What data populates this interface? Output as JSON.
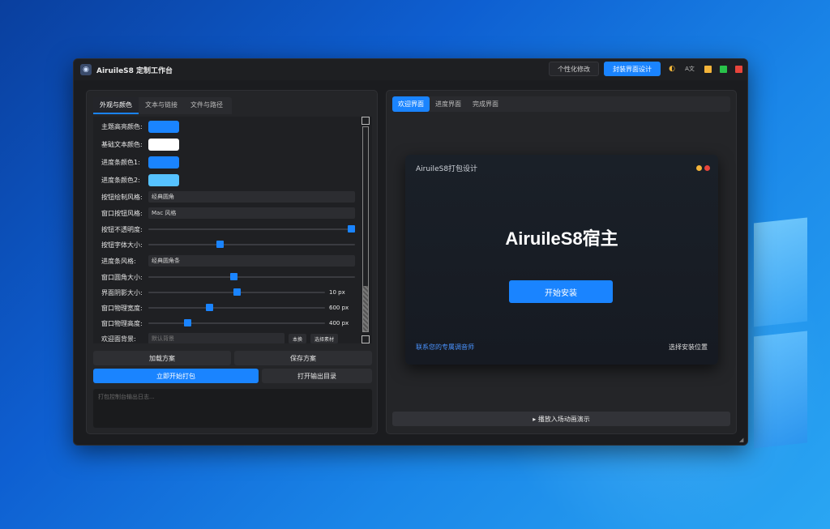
{
  "app": {
    "title": "AiruileS8 定制工作台"
  },
  "toolbar": {
    "personalize_label": "个性化修改",
    "design_label": "封装界面设计",
    "lang_label": "A文"
  },
  "colors": {
    "accent": "#1a84ff",
    "accent_light": "#56c2ff",
    "min": "#f4b43a",
    "max": "#29c24a",
    "close": "#e8453c"
  },
  "left": {
    "tabs": [
      {
        "label": "外观与颜色"
      },
      {
        "label": "文本与链接"
      },
      {
        "label": "文件与路径"
      }
    ],
    "fields": {
      "theme_color_label": "主题高亮颜色:",
      "text_color_label": "基础文本颜色:",
      "progress1_label": "进度条颜色1:",
      "progress2_label": "进度条颜色2:",
      "btn_style_label": "按钮绘制风格:",
      "btn_style_value": "经典圆角",
      "win_btn_label": "窗口按钮风格:",
      "win_btn_value": "Mac 风格",
      "opacity_label": "按钮不透明度:",
      "opacity_level": 1.0,
      "font_size_label": "按钮字体大小:",
      "font_size_level": 0.34,
      "progress_style_label": "进度条风格:",
      "progress_style_value": "经典圆角条",
      "radius_label": "窗口圆角大小:",
      "radius_level": 0.41,
      "shadow_label": "界面阴影大小:",
      "shadow_value": "10 px",
      "shadow_level": 0.5,
      "width_label": "窗口物理宽度:",
      "width_value": "600 px",
      "width_level": 0.34,
      "height_label": "窗口物理高度:",
      "height_value": "400 px",
      "height_level": 0.21,
      "bg_label": "欢迎面背景:",
      "bg_placeholder": "默认背景",
      "bg_replace": "本换",
      "bg_choose": "选择素材"
    },
    "load_label": "加载方案",
    "save_label": "保存方案",
    "build_label": "立即开始打包",
    "open_dir_label": "打开输出目录",
    "console_text": "打包控制台输出日志..."
  },
  "right": {
    "tabs": [
      {
        "label": "欢迎界面"
      },
      {
        "label": "进度界面"
      },
      {
        "label": "完成界面"
      }
    ],
    "preview": {
      "title": "AiruileS8打包设计",
      "main_title": "AiruileS8宿主",
      "install_label": "开始安装",
      "contact_label": "联系您的专属调音师",
      "location_label": "选择安装位置"
    },
    "anim_label": "▸ 播放入场动画演示"
  }
}
